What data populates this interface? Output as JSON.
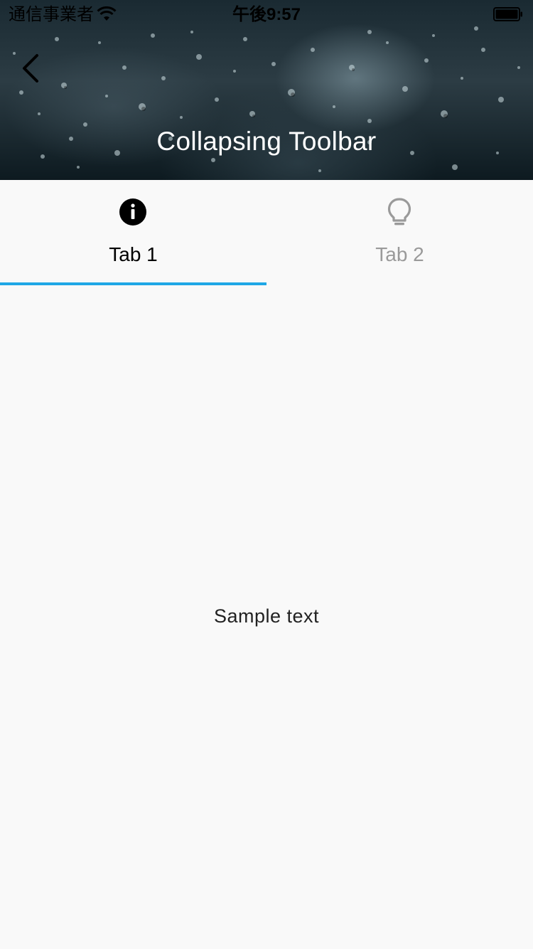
{
  "status_bar": {
    "carrier": "通信事業者",
    "time": "午後9:57",
    "icons": [
      "wifi-icon",
      "battery-icon"
    ]
  },
  "app_bar": {
    "back_icon": "chevron-left-icon",
    "title": "Collapsing Toolbar"
  },
  "tabs": [
    {
      "label": "Tab 1",
      "icon": "info-icon",
      "selected": true
    },
    {
      "label": "Tab 2",
      "icon": "lightbulb-icon",
      "selected": false
    }
  ],
  "colors": {
    "indicator": "#1fa7e6",
    "selected_tab": "#000000",
    "unselected_tab": "#9a9a9a",
    "background": "#f9f9f9"
  },
  "content": {
    "text": "Sample text"
  }
}
